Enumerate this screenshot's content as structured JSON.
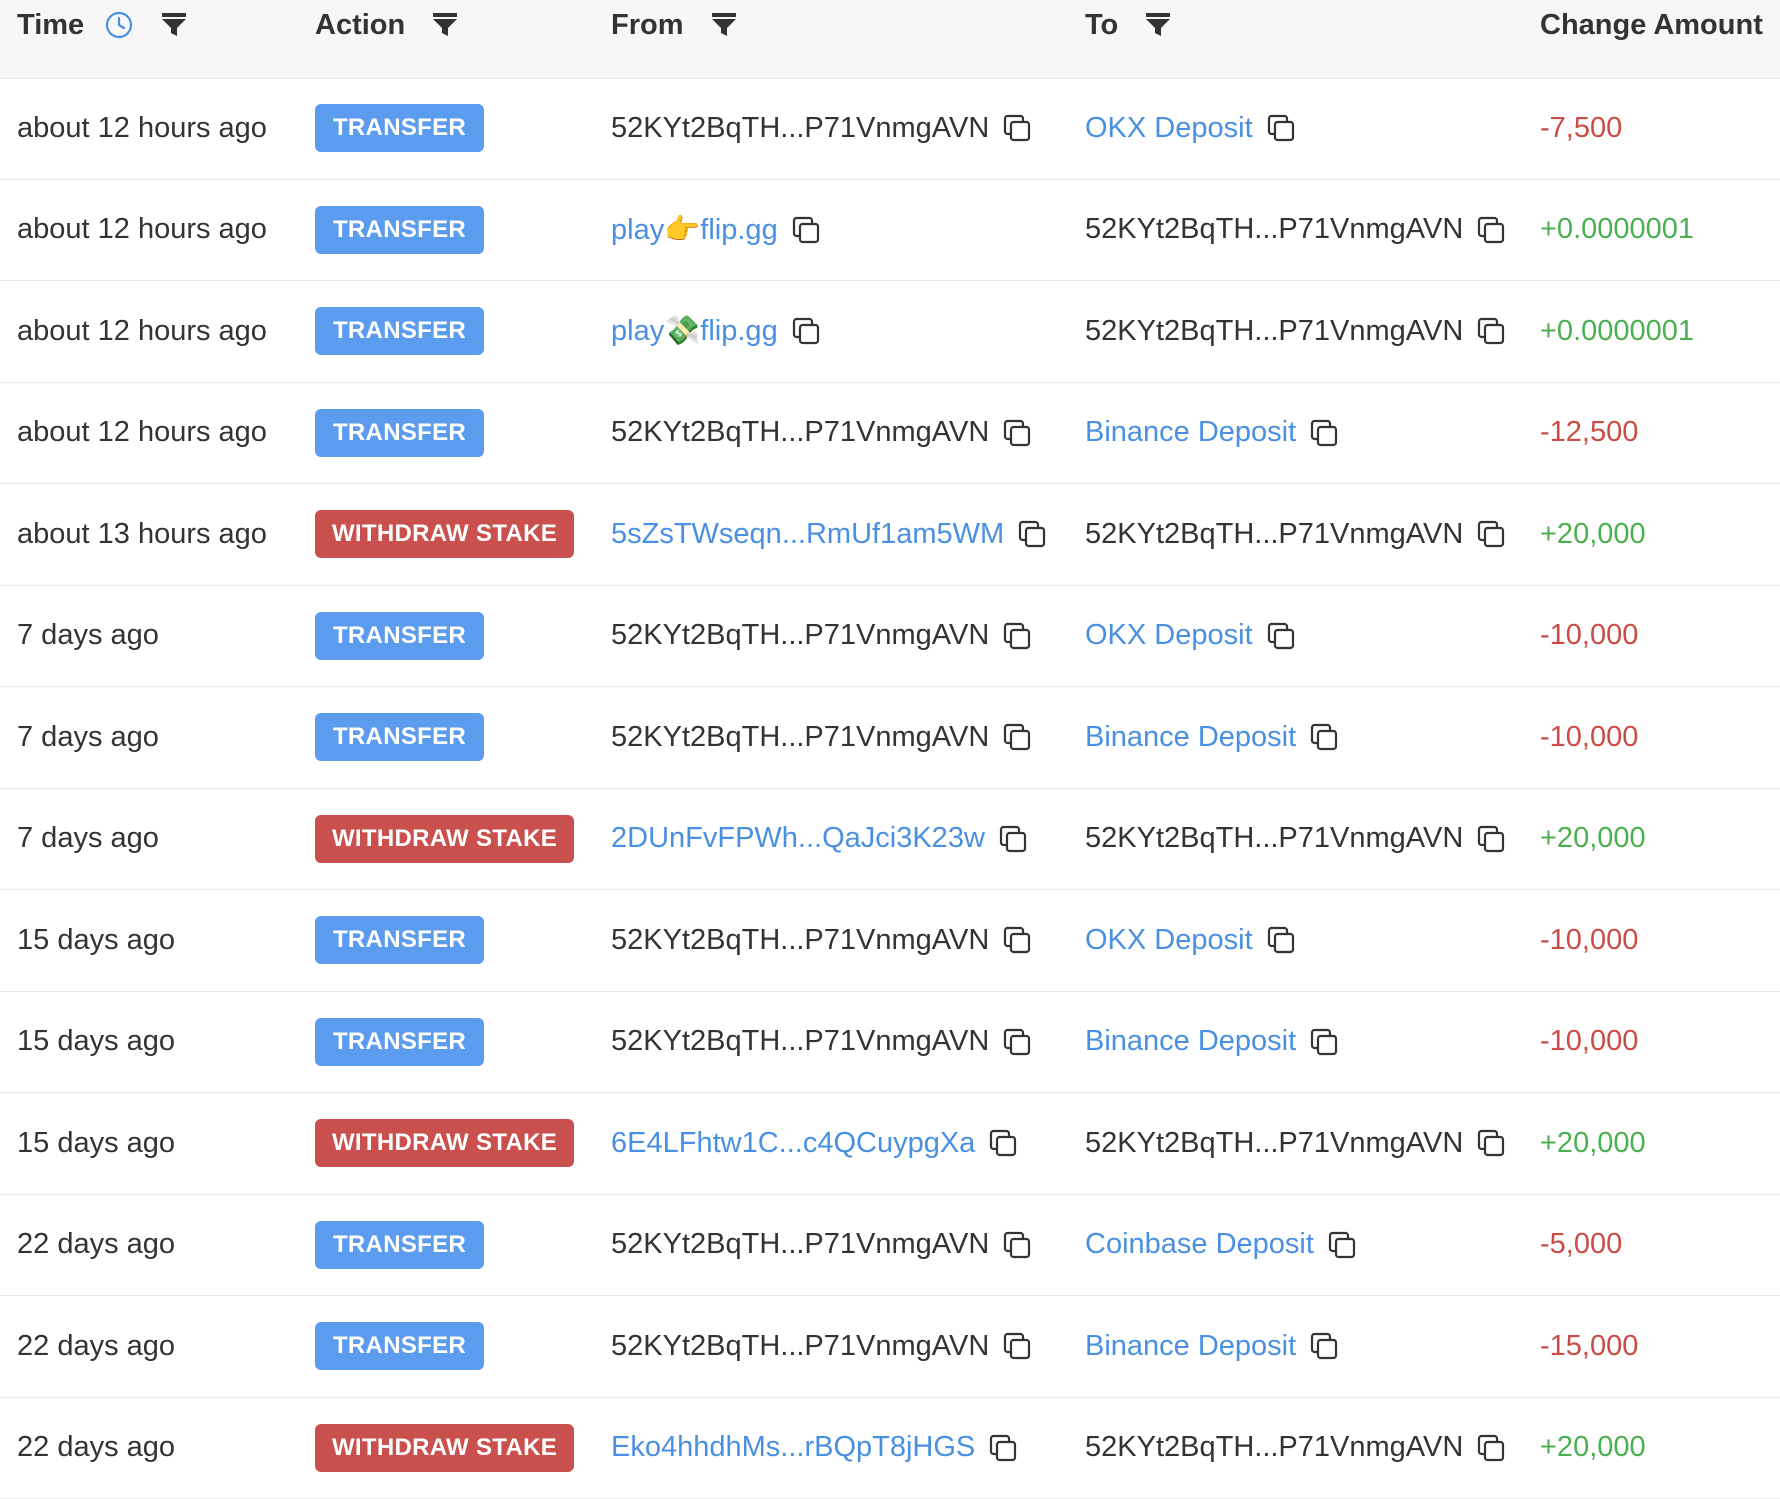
{
  "header": {
    "time": "Time",
    "action": "Action",
    "from": "From",
    "to": "To",
    "change_amount": "Change Amount"
  },
  "colors": {
    "transfer_badge": "#5b9cef",
    "withdraw_badge": "#c9504c",
    "link": "#4a90e2",
    "negative": "#cc4b45",
    "positive": "#4caf50"
  },
  "rows": [
    {
      "time": "about 12 hours ago",
      "action": "TRANSFER",
      "action_type": "transfer",
      "from": "52KYt2BqTH...P71VnmgAVN",
      "from_link": false,
      "to": "OKX Deposit",
      "to_link": true,
      "amount": "-7,500",
      "sign": "neg"
    },
    {
      "time": "about 12 hours ago",
      "action": "TRANSFER",
      "action_type": "transfer",
      "from": "play👉flip.gg",
      "from_link": true,
      "to": "52KYt2BqTH...P71VnmgAVN",
      "to_link": false,
      "amount": "+0.0000001",
      "sign": "pos"
    },
    {
      "time": "about 12 hours ago",
      "action": "TRANSFER",
      "action_type": "transfer",
      "from": "play💸flip.gg",
      "from_link": true,
      "to": "52KYt2BqTH...P71VnmgAVN",
      "to_link": false,
      "amount": "+0.0000001",
      "sign": "pos"
    },
    {
      "time": "about 12 hours ago",
      "action": "TRANSFER",
      "action_type": "transfer",
      "from": "52KYt2BqTH...P71VnmgAVN",
      "from_link": false,
      "to": "Binance Deposit",
      "to_link": true,
      "amount": "-12,500",
      "sign": "neg"
    },
    {
      "time": "about 13 hours ago",
      "action": "WITHDRAW STAKE",
      "action_type": "withdraw",
      "from": "5sZsTWseqn...RmUf1am5WM",
      "from_link": true,
      "to": "52KYt2BqTH...P71VnmgAVN",
      "to_link": false,
      "amount": "+20,000",
      "sign": "pos"
    },
    {
      "time": "7 days ago",
      "action": "TRANSFER",
      "action_type": "transfer",
      "from": "52KYt2BqTH...P71VnmgAVN",
      "from_link": false,
      "to": "OKX Deposit",
      "to_link": true,
      "amount": "-10,000",
      "sign": "neg"
    },
    {
      "time": "7 days ago",
      "action": "TRANSFER",
      "action_type": "transfer",
      "from": "52KYt2BqTH...P71VnmgAVN",
      "from_link": false,
      "to": "Binance Deposit",
      "to_link": true,
      "amount": "-10,000",
      "sign": "neg"
    },
    {
      "time": "7 days ago",
      "action": "WITHDRAW STAKE",
      "action_type": "withdraw",
      "from": "2DUnFvFPWh...QaJci3K23w",
      "from_link": true,
      "to": "52KYt2BqTH...P71VnmgAVN",
      "to_link": false,
      "amount": "+20,000",
      "sign": "pos"
    },
    {
      "time": "15 days ago",
      "action": "TRANSFER",
      "action_type": "transfer",
      "from": "52KYt2BqTH...P71VnmgAVN",
      "from_link": false,
      "to": "OKX Deposit",
      "to_link": true,
      "amount": "-10,000",
      "sign": "neg"
    },
    {
      "time": "15 days ago",
      "action": "TRANSFER",
      "action_type": "transfer",
      "from": "52KYt2BqTH...P71VnmgAVN",
      "from_link": false,
      "to": "Binance Deposit",
      "to_link": true,
      "amount": "-10,000",
      "sign": "neg"
    },
    {
      "time": "15 days ago",
      "action": "WITHDRAW STAKE",
      "action_type": "withdraw",
      "from": "6E4LFhtw1C...c4QCuypgXa",
      "from_link": true,
      "to": "52KYt2BqTH...P71VnmgAVN",
      "to_link": false,
      "amount": "+20,000",
      "sign": "pos"
    },
    {
      "time": "22 days ago",
      "action": "TRANSFER",
      "action_type": "transfer",
      "from": "52KYt2BqTH...P71VnmgAVN",
      "from_link": false,
      "to": "Coinbase Deposit",
      "to_link": true,
      "amount": "-5,000",
      "sign": "neg"
    },
    {
      "time": "22 days ago",
      "action": "TRANSFER",
      "action_type": "transfer",
      "from": "52KYt2BqTH...P71VnmgAVN",
      "from_link": false,
      "to": "Binance Deposit",
      "to_link": true,
      "amount": "-15,000",
      "sign": "neg"
    },
    {
      "time": "22 days ago",
      "action": "WITHDRAW STAKE",
      "action_type": "withdraw",
      "from": "Eko4hhdhMs...rBQpT8jHGS",
      "from_link": true,
      "to": "52KYt2BqTH...P71VnmgAVN",
      "to_link": false,
      "amount": "+20,000",
      "sign": "pos"
    }
  ]
}
